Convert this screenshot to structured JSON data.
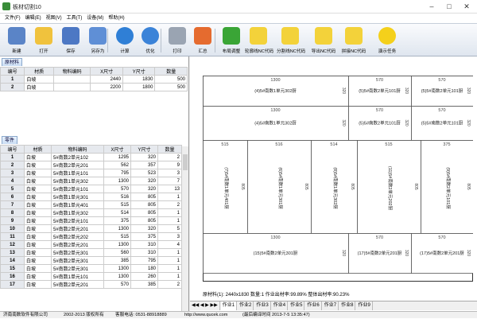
{
  "window": {
    "title": "板材切割10"
  },
  "menu": [
    "文件(F)",
    "编辑(E)",
    "视图(V)",
    "工具(T)",
    "设备(M)",
    "帮助(H)"
  ],
  "toolbar": [
    {
      "label": "新建",
      "icon": "new-icon",
      "color": "#5a84c7"
    },
    {
      "label": "打开",
      "icon": "open-folder-icon",
      "color": "#f0c23d"
    },
    {
      "label": "保存",
      "icon": "save-disk-icon",
      "color": "#4d78c4"
    },
    {
      "label": "另存为",
      "icon": "save-as-icon",
      "color": "#5f8fd6"
    },
    {
      "label": "计算",
      "icon": "play-icon",
      "color": "#2f7fd6"
    },
    {
      "label": "优化",
      "icon": "eject-icon",
      "color": "#3b83d8"
    },
    {
      "label": "打印",
      "icon": "printer-icon",
      "color": "#9aa4b2"
    },
    {
      "label": "汇总",
      "icon": "pie-chart-icon",
      "color": "#e56b2f"
    },
    {
      "label": "布局调整",
      "icon": "refresh-icon",
      "color": "#3aa536"
    },
    {
      "label": "轮廓线NC代码",
      "icon": "pin-note-icon",
      "color": "#f3d23a"
    },
    {
      "label": "分割线NC代码",
      "icon": "pin-note-icon",
      "color": "#f3d23a"
    },
    {
      "label": "导出NC代码",
      "icon": "pin-note-icon",
      "color": "#f3d23a"
    },
    {
      "label": "拼接NC代码",
      "icon": "pin-note-icon",
      "color": "#f3d23a"
    },
    {
      "label": "演示任务",
      "icon": "smiley-icon",
      "color": "#f4d01b"
    }
  ],
  "material": {
    "tab": "原材料",
    "headers": [
      "编号",
      "材质",
      "物料编码",
      "X尺寸",
      "Y尺寸",
      "数量"
    ],
    "rows": [
      [
        "1",
        "白坡",
        "",
        "2440",
        "1830",
        "500"
      ],
      [
        "2",
        "白坡",
        "",
        "2200",
        "1800",
        "500"
      ]
    ]
  },
  "parts": {
    "tab": "零件",
    "headers": [
      "编号",
      "材质",
      "物料编码",
      "X尺寸",
      "Y尺寸",
      "数量"
    ],
    "rows": [
      [
        "1",
        "白坡",
        "5#南数2单元102",
        "1295",
        "320",
        "2"
      ],
      [
        "2",
        "白坡",
        "5#南数2单元201",
        "562",
        "357",
        "9"
      ],
      [
        "3",
        "白坡",
        "5#南数1单元101",
        "795",
        "523",
        "3"
      ],
      [
        "4",
        "白坡",
        "5#南数1单元302",
        "1300",
        "320",
        "7"
      ],
      [
        "5",
        "白坡",
        "5#南数2单元101",
        "570",
        "320",
        "13"
      ],
      [
        "6",
        "白坡",
        "5#南数1单元301",
        "516",
        "805",
        "1"
      ],
      [
        "7",
        "白坡",
        "5#南数1单元401",
        "515",
        "805",
        "2"
      ],
      [
        "8",
        "白坡",
        "5#南数1单元302",
        "514",
        "805",
        "1"
      ],
      [
        "9",
        "白坡",
        "5#南数2单元101",
        "375",
        "805",
        "1"
      ],
      [
        "10",
        "白坡",
        "5#南数2单元201",
        "1300",
        "320",
        "5"
      ],
      [
        "11",
        "白坡",
        "5#南数2单元202",
        "515",
        "375",
        "3"
      ],
      [
        "12",
        "白坡",
        "5#南数2单元201",
        "1300",
        "310",
        "4"
      ],
      [
        "13",
        "白坡",
        "5#南数2单元301",
        "560",
        "310",
        "1"
      ],
      [
        "14",
        "白坡",
        "5#南数2单元301",
        "385",
        "795",
        "1"
      ],
      [
        "15",
        "白坡",
        "5#南数2单元301",
        "1300",
        "180",
        "1"
      ],
      [
        "16",
        "白坡",
        "5#南数1单元101",
        "1300",
        "260",
        "1"
      ],
      [
        "17",
        "白坡",
        "5#南数2单元201",
        "570",
        "385",
        "2"
      ]
    ]
  },
  "layout": {
    "row1": [
      {
        "label": "(4)5#南数1单元302厨",
        "top": "1300",
        "side": "320",
        "w": "w1300"
      },
      {
        "label": "(5)5#南数2单元101厨",
        "top": "570",
        "side": "320",
        "w": "w570"
      },
      {
        "label": "(5)5#南数2单元101厨",
        "top": "570",
        "side": "320",
        "w": "w570"
      }
    ],
    "row2": [
      {
        "label": "(4)5#南数1单元302厨",
        "top": "1300",
        "side": "320"
      },
      {
        "label": "(5)5#南数2单元101厨",
        "top": "570",
        "side": "320"
      },
      {
        "label": "(5)5#南数2单元101厨",
        "top": "570",
        "side": "320"
      }
    ],
    "row3": [
      {
        "label": "(7)5#南数1单元401厨",
        "top": "515",
        "side": "805"
      },
      {
        "label": "(6)5#南数1单元301厨",
        "top": "516",
        "side": "805"
      },
      {
        "label": "(8)5#南数1单元302厨",
        "top": "514",
        "side": "805"
      },
      {
        "label": "(11)5#南数2单元202厨",
        "top": "515",
        "side": "805"
      },
      {
        "label": "(9)5#南数2单元101厨",
        "top": "375",
        "side": "805"
      }
    ],
    "row4": [
      {
        "label": "(15)5#南数2单元301厨",
        "top": "1300",
        "side": "320"
      },
      {
        "label": "(17)5#南数2单元201厨",
        "top": "570",
        "side": "320"
      },
      {
        "label": "(17)5#南数2单元201厨",
        "top": "570",
        "side": "320"
      }
    ],
    "info": "原材料(1): 2440x1830 数量:1 作业出材率:99.89% 整体出材率:90.23%"
  },
  "sheet_tabs": [
    "作业1",
    "作业2",
    "作业3",
    "作业4",
    "作业5",
    "作业6",
    "作业7",
    "作业8",
    "作业9"
  ],
  "status": {
    "company": "济南南数软件有限公司",
    "copyright": "2002-2013 版权所有",
    "phone": "客服电话: 0531-88918889",
    "url": "http://www.qucek.com",
    "time": "(最后编译时间 2013-7-5 13:35:47)"
  }
}
